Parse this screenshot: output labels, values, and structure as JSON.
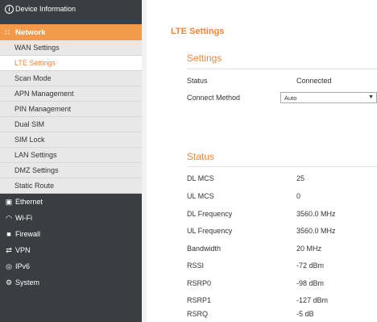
{
  "sidebar": {
    "device_info": "Device Information",
    "network": "Network",
    "network_items": [
      "WAN Settings",
      "LTE Settings",
      "Scan Mode",
      "APN Management",
      "PIN Management",
      "Dual SIM",
      "SIM Lock",
      "LAN Settings",
      "DMZ Settings",
      "Static Route"
    ],
    "ethernet": "Ethernet",
    "wifi": "Wi-Fi",
    "firewall": "Firewall",
    "vpn": "VPN",
    "ipv6": "IPv6",
    "system": "System"
  },
  "main": {
    "title": "LTE Settings",
    "settings_title": "Settings",
    "status_label": "Status",
    "status_value": "Connected",
    "connect_method_label": "Connect Method",
    "connect_method_value": "Auto",
    "status_title": "Status",
    "rows": [
      {
        "label": "DL MCS",
        "value": "25"
      },
      {
        "label": "UL MCS",
        "value": "0"
      },
      {
        "label": "DL Frequency",
        "value": "3560.0 MHz"
      },
      {
        "label": "UL Frequency",
        "value": "3560.0 MHz"
      },
      {
        "label": "Bandwidth",
        "value": "20 MHz"
      },
      {
        "label": "RSSI",
        "value": "-72 dBm"
      },
      {
        "label": "RSRP0",
        "value": "-98 dBm"
      },
      {
        "label": "RSRP1",
        "value": "-127 dBm"
      },
      {
        "label": "RSRQ",
        "value": "-5 dB"
      }
    ]
  },
  "colors": {
    "accent": "#f0873a",
    "sidebar_bg": "#3a3d42",
    "section_bg": "#f29a4a"
  }
}
